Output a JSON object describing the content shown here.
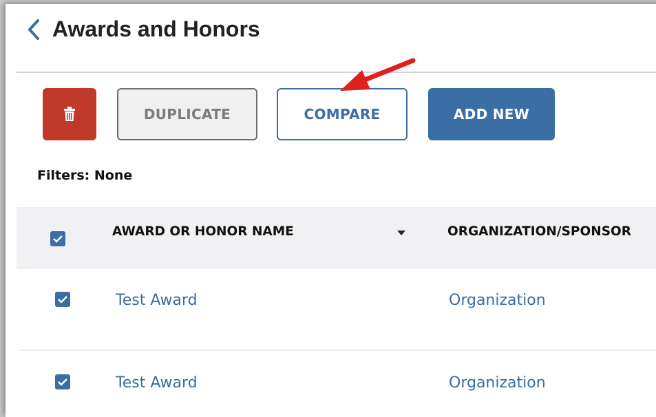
{
  "header": {
    "title": "Awards and Honors"
  },
  "toolbar": {
    "delete_icon": "trash-icon",
    "duplicate_label": "DUPLICATE",
    "compare_label": "COMPARE",
    "add_new_label": "ADD NEW"
  },
  "filters": {
    "text": "Filters: None"
  },
  "table": {
    "columns": [
      "AWARD OR HONOR NAME",
      "ORGANIZATION/SPONSOR"
    ],
    "select_all_checked": true,
    "rows": [
      {
        "checked": true,
        "award": "Test Award",
        "organization": "Organization"
      },
      {
        "checked": true,
        "award": "Test Award",
        "organization": "Organization"
      }
    ]
  },
  "colors": {
    "accent": "#3a6ea5",
    "delete": "#c0392b",
    "annotation_arrow": "#e0201c"
  }
}
